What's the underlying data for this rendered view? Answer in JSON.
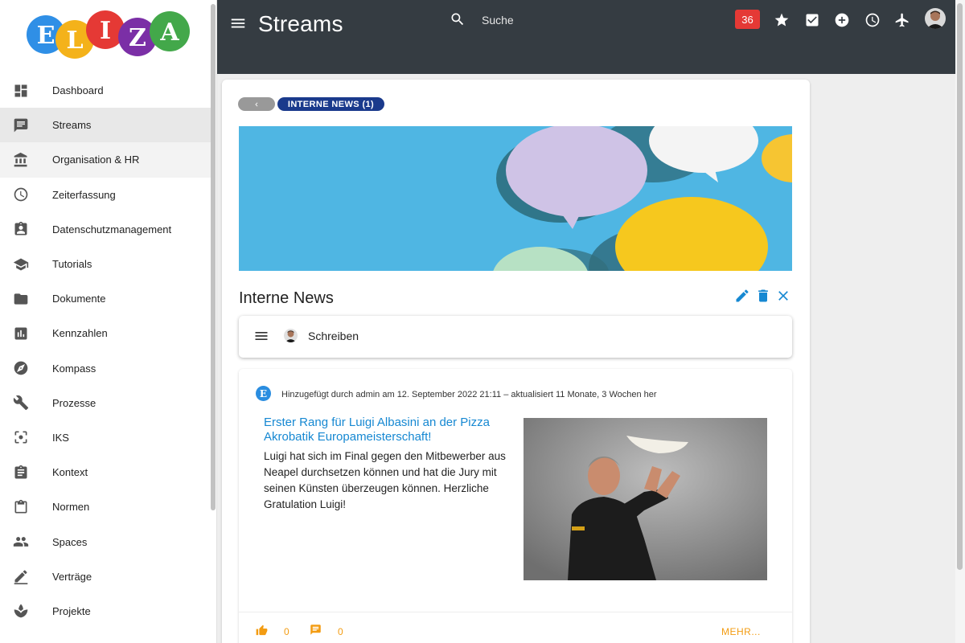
{
  "app": {
    "name": "ELIZA"
  },
  "header": {
    "title": "Streams",
    "search_placeholder": "Suche",
    "badge_count": "36"
  },
  "sidebar": {
    "items": [
      {
        "label": "Dashboard",
        "icon": "dashboard-icon"
      },
      {
        "label": "Streams",
        "icon": "chat-icon"
      },
      {
        "label": "Organisation & HR",
        "icon": "bank-icon"
      },
      {
        "label": "Zeiterfassung",
        "icon": "clock-icon"
      },
      {
        "label": "Datenschutzmanagement",
        "icon": "clipboard-user-icon"
      },
      {
        "label": "Tutorials",
        "icon": "graduation-cap-icon"
      },
      {
        "label": "Dokumente",
        "icon": "folder-icon"
      },
      {
        "label": "Kennzahlen",
        "icon": "bar-chart-icon"
      },
      {
        "label": "Kompass",
        "icon": "compass-icon"
      },
      {
        "label": "Prozesse",
        "icon": "wrench-icon"
      },
      {
        "label": "IKS",
        "icon": "focus-icon"
      },
      {
        "label": "Kontext",
        "icon": "assignment-icon"
      },
      {
        "label": "Normen",
        "icon": "clipboard-icon"
      },
      {
        "label": "Spaces",
        "icon": "people-icon"
      },
      {
        "label": "Verträge",
        "icon": "pen-icon"
      },
      {
        "label": "Projekte",
        "icon": "spa-icon"
      }
    ]
  },
  "main": {
    "chip_label": "INTERNE NEWS (1)",
    "section_title": "Interne News",
    "write_label": "Schreiben",
    "post": {
      "logo_letter": "E",
      "meta": "Hinzugefügt durch admin am 12. September 2022 21:11 – aktualisiert 11 Monate, 3 Wochen her",
      "title": "Erster Rang für Luigi Albasini an der Pizza Akrobatik Europameisterschaft!",
      "body": "Luigi hat sich im Final gegen den Mitbewerber aus Neapel durchsetzen können und hat die Jury mit seinen Künsten überzeugen können. Herzliche Gratulation Luigi!",
      "likes": "0",
      "comments": "0",
      "more_label": "MEHR..."
    }
  },
  "colors": {
    "header_bg": "#353c42",
    "accent_blue": "#1688d2",
    "chip_blue": "#1a3a8c",
    "badge_red": "#e53935",
    "action_orange": "#f39c12"
  }
}
